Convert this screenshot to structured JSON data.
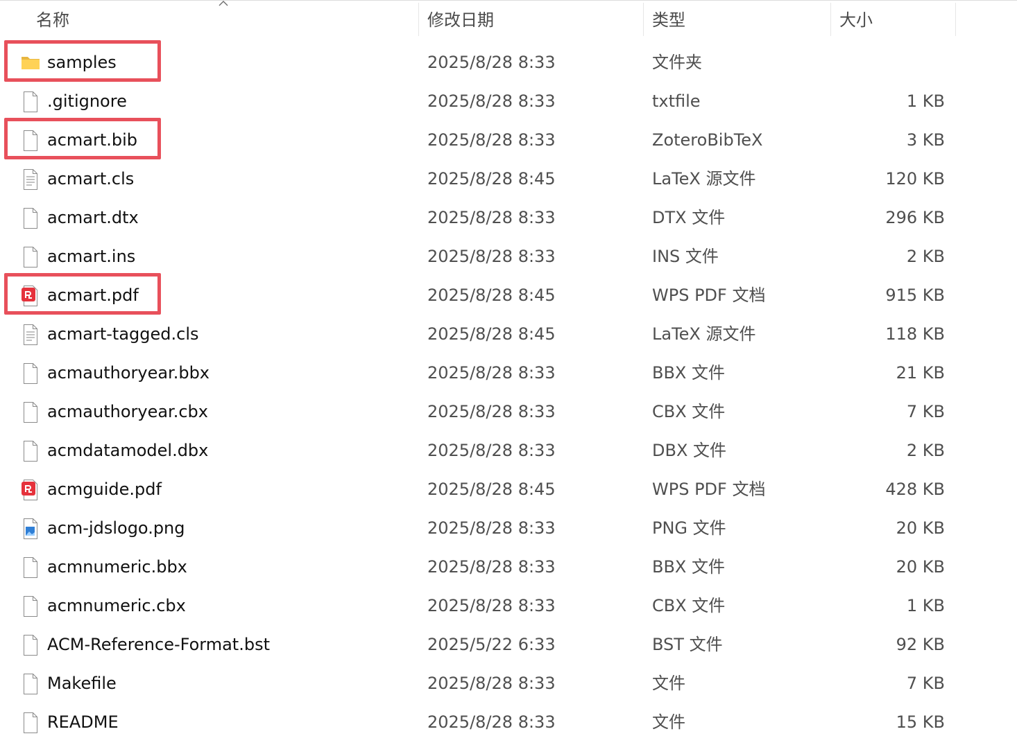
{
  "header": {
    "name": "名称",
    "modified": "修改日期",
    "type": "类型",
    "size": "大小"
  },
  "highlight_color": "#e8505b",
  "files": [
    {
      "name": "samples",
      "date": "2025/8/28 8:33",
      "type": "文件夹",
      "size": "",
      "icon": "folder-icon",
      "highlighted": true
    },
    {
      "name": ".gitignore",
      "date": "2025/8/28 8:33",
      "type": "txtfile",
      "size": "1 KB",
      "icon": "file-icon",
      "highlighted": false
    },
    {
      "name": "acmart.bib",
      "date": "2025/8/28 8:33",
      "type": "ZoteroBibTeX",
      "size": "3 KB",
      "icon": "file-icon",
      "highlighted": true
    },
    {
      "name": "acmart.cls",
      "date": "2025/8/28 8:45",
      "type": "LaTeX 源文件",
      "size": "120 KB",
      "icon": "text-file-icon",
      "highlighted": false
    },
    {
      "name": "acmart.dtx",
      "date": "2025/8/28 8:33",
      "type": "DTX 文件",
      "size": "296 KB",
      "icon": "file-icon",
      "highlighted": false
    },
    {
      "name": "acmart.ins",
      "date": "2025/8/28 8:33",
      "type": "INS 文件",
      "size": "2 KB",
      "icon": "file-icon",
      "highlighted": false
    },
    {
      "name": "acmart.pdf",
      "date": "2025/8/28 8:45",
      "type": "WPS PDF 文档",
      "size": "915 KB",
      "icon": "pdf-icon",
      "highlighted": true
    },
    {
      "name": "acmart-tagged.cls",
      "date": "2025/8/28 8:45",
      "type": "LaTeX 源文件",
      "size": "118 KB",
      "icon": "text-file-icon",
      "highlighted": false
    },
    {
      "name": "acmauthoryear.bbx",
      "date": "2025/8/28 8:33",
      "type": "BBX 文件",
      "size": "21 KB",
      "icon": "file-icon",
      "highlighted": false
    },
    {
      "name": "acmauthoryear.cbx",
      "date": "2025/8/28 8:33",
      "type": "CBX 文件",
      "size": "7 KB",
      "icon": "file-icon",
      "highlighted": false
    },
    {
      "name": "acmdatamodel.dbx",
      "date": "2025/8/28 8:33",
      "type": "DBX 文件",
      "size": "2 KB",
      "icon": "file-icon",
      "highlighted": false
    },
    {
      "name": "acmguide.pdf",
      "date": "2025/8/28 8:45",
      "type": "WPS PDF 文档",
      "size": "428 KB",
      "icon": "pdf-icon",
      "highlighted": false
    },
    {
      "name": "acm-jdslogo.png",
      "date": "2025/8/28 8:33",
      "type": "PNG 文件",
      "size": "20 KB",
      "icon": "image-file-icon",
      "highlighted": false
    },
    {
      "name": "acmnumeric.bbx",
      "date": "2025/8/28 8:33",
      "type": "BBX 文件",
      "size": "20 KB",
      "icon": "file-icon",
      "highlighted": false
    },
    {
      "name": "acmnumeric.cbx",
      "date": "2025/8/28 8:33",
      "type": "CBX 文件",
      "size": "1 KB",
      "icon": "file-icon",
      "highlighted": false
    },
    {
      "name": "ACM-Reference-Format.bst",
      "date": "2025/5/22 6:33",
      "type": "BST 文件",
      "size": "92 KB",
      "icon": "file-icon",
      "highlighted": false
    },
    {
      "name": "Makefile",
      "date": "2025/8/28 8:33",
      "type": "文件",
      "size": "7 KB",
      "icon": "file-icon",
      "highlighted": false
    },
    {
      "name": "README",
      "date": "2025/8/28 8:33",
      "type": "文件",
      "size": "15 KB",
      "icon": "file-icon",
      "highlighted": false
    }
  ]
}
